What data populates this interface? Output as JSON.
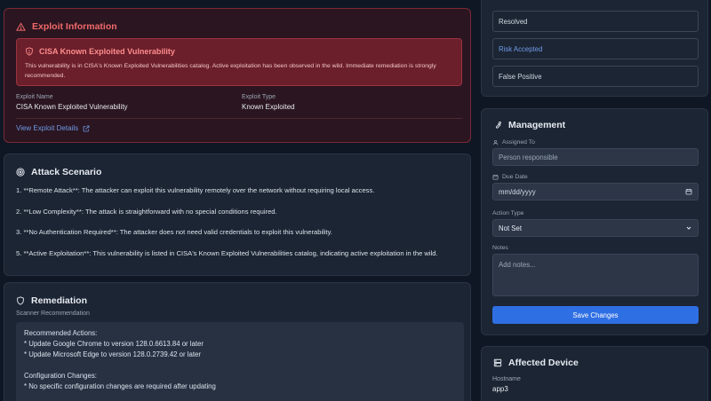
{
  "exploit": {
    "title": "Exploit Information",
    "alert_title": "CISA Known Exploited Vulnerability",
    "alert_message": "This vulnerability is in CISA's Known Exploited Vulnerabilities catalog. Active exploitation has been observed in the wild. Immediate remediation is strongly recommended.",
    "name_label": "Exploit Name",
    "name_value": "CISA Known Exploited Vulnerability",
    "type_label": "Exploit Type",
    "type_value": "Known Exploited",
    "link": "View Exploit Details"
  },
  "attack": {
    "title": "Attack Scenario",
    "lines": [
      "1. **Remote Attack**: The attacker can exploit this vulnerability remotely over the network without requiring local access.",
      "2. **Low Complexity**: The attack is straightforward with no special conditions required.",
      "3. **No Authentication Required**: The attacker does not need valid credentials to exploit this vulnerability.",
      "5. **Active Exploitation**: This vulnerability is listed in CISA's Known Exploited Vulnerabilities catalog, indicating active exploitation in the wild."
    ]
  },
  "remediation": {
    "title": "Remediation",
    "subtitle": "Scanner Recommendation",
    "lines": [
      "Recommended Actions:",
      "* Update Google Chrome to version 128.0.6613.84 or later",
      "* Update Microsoft Edge to version 128.0.2739.42 or later",
      "",
      "Configuration Changes:",
      "* No specific configuration changes are required after updating"
    ]
  },
  "status": {
    "options": [
      "Resolved",
      "Risk Accepted",
      "False Positive"
    ],
    "active_color": "#6f9be8"
  },
  "management": {
    "title": "Management",
    "assigned_label": "Assigned To",
    "assigned_placeholder": "Person responsible",
    "due_label": "Due Date",
    "due_value": "mm/dd/yyyy",
    "action_label": "Action Type",
    "action_value": "Not Set",
    "notes_label": "Notes",
    "notes_placeholder": "Add notes...",
    "save": "Save Changes"
  },
  "device": {
    "title": "Affected Device",
    "hostname_label": "Hostname",
    "hostname_value": "app3"
  },
  "colors": {
    "accent": "#2f6fe4",
    "danger": "#f06a6a"
  }
}
